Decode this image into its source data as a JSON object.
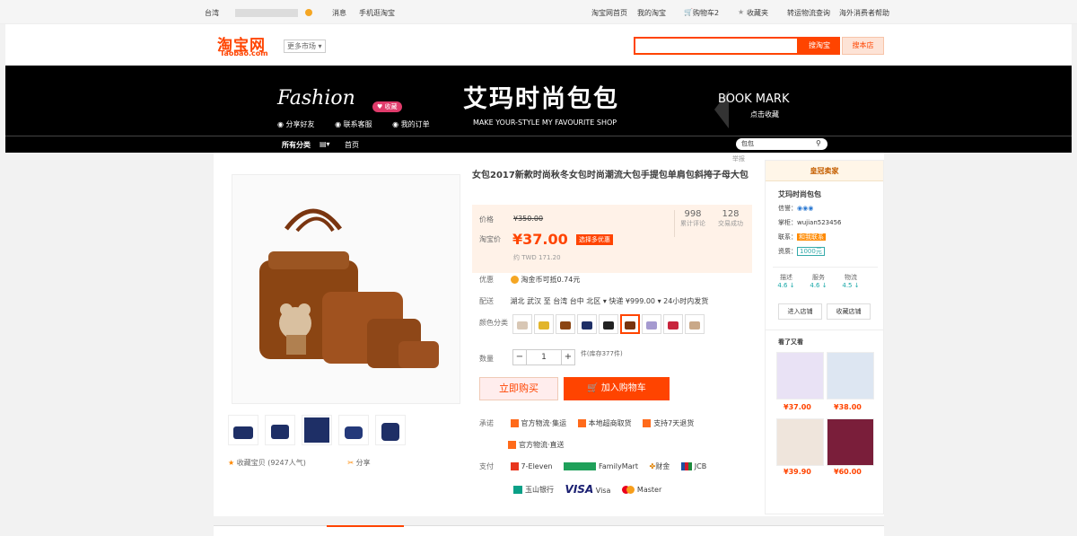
{
  "topbar": {
    "region": "台湾",
    "user_blurred": "",
    "notice": "消息",
    "mobile": "手机逛淘宝",
    "home": "淘宝网首页",
    "my_taobao": "我的淘宝",
    "cart": "购物车2",
    "favorites": "收藏夹",
    "cargo": "转运物流查询",
    "help": "海外消费者帮助"
  },
  "header": {
    "logo": "淘宝网",
    "logo_sub": "Taobao.com",
    "more_market": "更多市场",
    "search_btn": "搜淘宝",
    "search_shop_btn": "搜本店"
  },
  "banner": {
    "fashion": "Fashion",
    "fav_pill": "♥ 收藏",
    "share": "分享好友",
    "consult": "联系客服",
    "orders": "我的订单",
    "shop_name": "艾玛时尚包包",
    "shop_sub": "MAKE YOUR-STYLE MY FAVOURITE SHOP",
    "bookmark": "BOOK MARK",
    "bookmark_sub": "点击收藏"
  },
  "nav": {
    "all": "所有分类",
    "home": "首页",
    "shop_search": "包包"
  },
  "breadcrumb": "举报",
  "product": {
    "title": "女包2017新款时尚秋冬女包时尚潮流大包手提包单肩包斜挎子母大包",
    "price_label": "价格",
    "old_price": "¥350.00",
    "tb_price_label": "淘宝价",
    "new_price": "¥37.00",
    "promo": "选择多优惠",
    "twd": "约 TWD 171.20",
    "reviews_count": "998",
    "reviews_label": "累计评论",
    "sold_count": "128",
    "sold_label": "交易成功",
    "discount_label": "优惠",
    "discount": "淘金币可抵0.74元",
    "ship_label": "配送",
    "ship_from": "湖北 武汉 至",
    "ship_to": "台湾 台中 北区",
    "ship_fee": "快递 ¥999.00",
    "ship_time": "24小时内发货",
    "color_label": "颜色分类",
    "qty_label": "数量",
    "qty_value": "1",
    "stock": "件(库存377件)",
    "buy_now": "立即购买",
    "add_cart": "加入购物车",
    "promise_label": "承诺",
    "promise1": "官方物流·集运",
    "promise2": "本地超商取货",
    "promise3": "支持7天退货",
    "promise4": "官方物流·直送",
    "pay_label": "支付",
    "pay1": "7-Eleven",
    "pay2": "FamilyMart",
    "pay3": "财金",
    "pay4": "JCB",
    "pay5": "玉山银行",
    "pay6": "VISA",
    "pay7": "Visa",
    "pay8": "Master",
    "favorite": "收藏宝贝 (9247人气)",
    "share": "分享"
  },
  "seller": {
    "head": "皇冠卖家",
    "name": "艾玛时尚包包",
    "credit_label": "信誉：",
    "wangwang_label": "掌柜：",
    "wangwang": "wujian523456",
    "contact_label": "联系：",
    "contact": "和我联系",
    "qual_label": "资质：",
    "deposit": "1000元",
    "desc_label": "描述",
    "desc_score": "4.6 ↓",
    "serv_label": "服务",
    "serv_score": "4.6 ↓",
    "logi_label": "物流",
    "logi_score": "4.5 ↓",
    "enter_shop": "进入店铺",
    "fav_shop": "收藏店铺",
    "also_seen": "看了又看",
    "mini_prices": [
      "¥37.00",
      "¥38.00",
      "¥39.90",
      "¥60.00"
    ]
  },
  "colors": {
    "accent": "#ff4400",
    "brown": "#8b4513",
    "navy": "#1e2f66"
  }
}
